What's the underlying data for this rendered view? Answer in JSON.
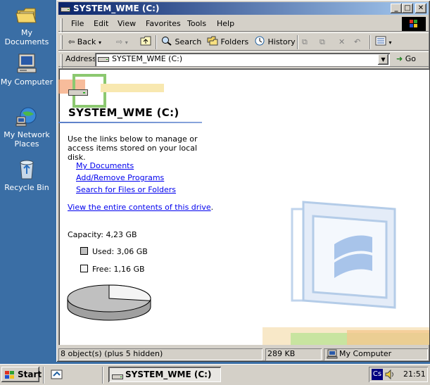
{
  "desktop": {
    "icons": [
      {
        "label": "My Documents"
      },
      {
        "label": "My Computer"
      },
      {
        "label": "My Network Places"
      },
      {
        "label": "Recycle Bin"
      }
    ]
  },
  "window": {
    "title": "SYSTEM_WME (C:)",
    "controls": {
      "minimize": "_",
      "maximize": "□",
      "close": "✕"
    }
  },
  "menubar": {
    "items": [
      "File",
      "Edit",
      "View",
      "Favorites",
      "Tools",
      "Help"
    ]
  },
  "toolbar": {
    "back": "Back",
    "search": "Search",
    "folders": "Folders",
    "history": "History"
  },
  "addressbar": {
    "label": "Address",
    "value": "SYSTEM_WME (C:)",
    "go": "Go"
  },
  "content": {
    "title": "SYSTEM_WME (C:)",
    "description": "Use the links below to manage or access items stored on your local disk.",
    "links": [
      "My Documents",
      "Add/Remove Programs",
      "Search for Files or Folders"
    ],
    "view_link": "View the entire contents of this drive",
    "view_suffix": ".",
    "capacity": "Capacity: 4,23 GB",
    "used": "Used: 3,06 GB",
    "free": "Free: 1,16 GB",
    "used_fraction": 0.723,
    "colors": {
      "used": "#c0c0c0",
      "free": "#f4f4f4"
    }
  },
  "statusbar": {
    "objects": "8 object(s) (plus 5 hidden)",
    "size": "289 KB",
    "zone": "My Computer"
  },
  "taskbar": {
    "start": "Start",
    "task": "SYSTEM_WME (C:)",
    "clock": "21:51",
    "lang": "Cs"
  }
}
